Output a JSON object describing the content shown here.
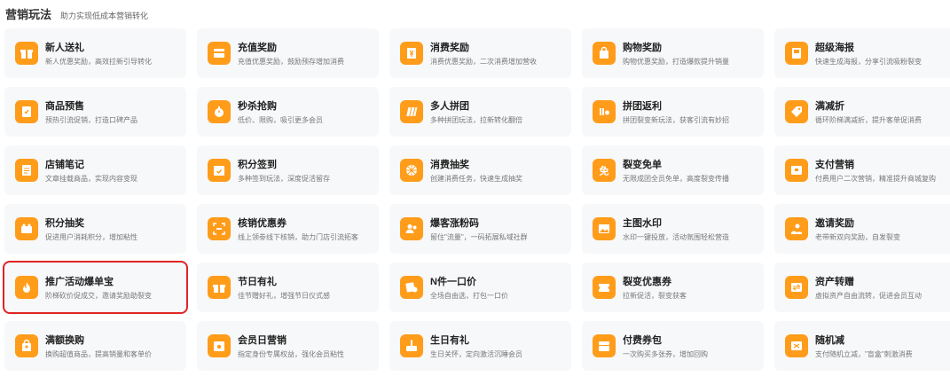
{
  "header": {
    "title": "营销玩法",
    "subtitle": "助力实现低成本营销转化"
  },
  "colors": {
    "accent": "#ff9c1a",
    "highlight": "#e02424"
  },
  "items": [
    {
      "title": "新人送礼",
      "desc": "新人优惠奖励，高效拉新引导转化",
      "icon": "gift-icon"
    },
    {
      "title": "充值奖励",
      "desc": "充值优惠奖励，鼓励预存增加消费",
      "icon": "recharge-icon"
    },
    {
      "title": "消费奖励",
      "desc": "消费优惠奖励，二次消费增加营收",
      "icon": "receipt-icon"
    },
    {
      "title": "购物奖励",
      "desc": "购物优惠奖励，打造爆款提升销量",
      "icon": "shopping-bag-icon"
    },
    {
      "title": "超级海报",
      "desc": "快速生成海报，分享引流吸粉裂变",
      "icon": "poster-icon"
    },
    {
      "title": "商品预售",
      "desc": "预热引流促销，打造口碑产品",
      "icon": "presale-icon"
    },
    {
      "title": "秒杀抢购",
      "desc": "低价、限购，吸引更多会员",
      "icon": "stopwatch-icon"
    },
    {
      "title": "多人拼团",
      "desc": "多种拼团玩法，拉新转化翻倍",
      "icon": "group-buy-icon"
    },
    {
      "title": "拼团返利",
      "desc": "拼团裂变新玩法，获客引流有妙招",
      "icon": "group-rebate-icon"
    },
    {
      "title": "满减折",
      "desc": "循环阶梯满减折，提升客单促消费",
      "icon": "tag-icon"
    },
    {
      "title": "店铺笔记",
      "desc": "文章挂载商品，实现内容变现",
      "icon": "note-icon"
    },
    {
      "title": "积分签到",
      "desc": "多种签到玩法，深度促活留存",
      "icon": "calendar-check-icon"
    },
    {
      "title": "消费抽奖",
      "desc": "创建消费任务，快速生成抽奖",
      "icon": "prize-wheel-icon"
    },
    {
      "title": "裂变免单",
      "desc": "无限成团全员免单，高度裂变传播",
      "icon": "free-order-icon"
    },
    {
      "title": "支付营销",
      "desc": "付费用户二次营销，精准提升商城复购",
      "icon": "payment-icon"
    },
    {
      "title": "积分抽奖",
      "desc": "促进用户消耗积分，增加粘性",
      "icon": "points-lottery-icon"
    },
    {
      "title": "核销优惠券",
      "desc": "线上领劵线下核销，助力门店引流拓客",
      "icon": "scan-icon"
    },
    {
      "title": "爆客涨粉码",
      "desc": "留住\"流量\"，一码拓展私域社群",
      "icon": "users-icon"
    },
    {
      "title": "主图水印",
      "desc": "水印一键投放，活动氛围轻松营造",
      "icon": "image-icon"
    },
    {
      "title": "邀请奖励",
      "desc": "老带新双向奖励，自发裂变",
      "icon": "invite-icon"
    },
    {
      "title": "推广活动爆单宝",
      "desc": "阶梯砍价促成交，邀请奖励助裂变",
      "icon": "flame-icon"
    },
    {
      "title": "节日有礼",
      "desc": "佳节赠好礼，增强节日仪式感",
      "icon": "festival-gift-icon"
    },
    {
      "title": "N件一口价",
      "desc": "全场自由选，打包一口价",
      "icon": "bundle-price-icon"
    },
    {
      "title": "裂变优惠券",
      "desc": "拉新促活，裂变获客",
      "icon": "coupon-icon"
    },
    {
      "title": "资产转赠",
      "desc": "虚拟资产自由流转，促进会员互动",
      "icon": "transfer-icon"
    },
    {
      "title": "满额换购",
      "desc": "换购超值商品，提高销量和客单价",
      "icon": "exchange-bag-icon"
    },
    {
      "title": "会员日营销",
      "desc": "指定身份专属权益，强化会员粘性",
      "icon": "member-day-icon"
    },
    {
      "title": "生日有礼",
      "desc": "生日关怀，定向激活沉睡会员",
      "icon": "cake-icon"
    },
    {
      "title": "付费券包",
      "desc": "一次购买多张券，增加回购",
      "icon": "coupon-pack-icon"
    },
    {
      "title": "随机减",
      "desc": "支付随机立减，\"盲盒\"刺激消费",
      "icon": "random-discount-icon"
    }
  ],
  "selected_item": "推广活动爆单宝"
}
